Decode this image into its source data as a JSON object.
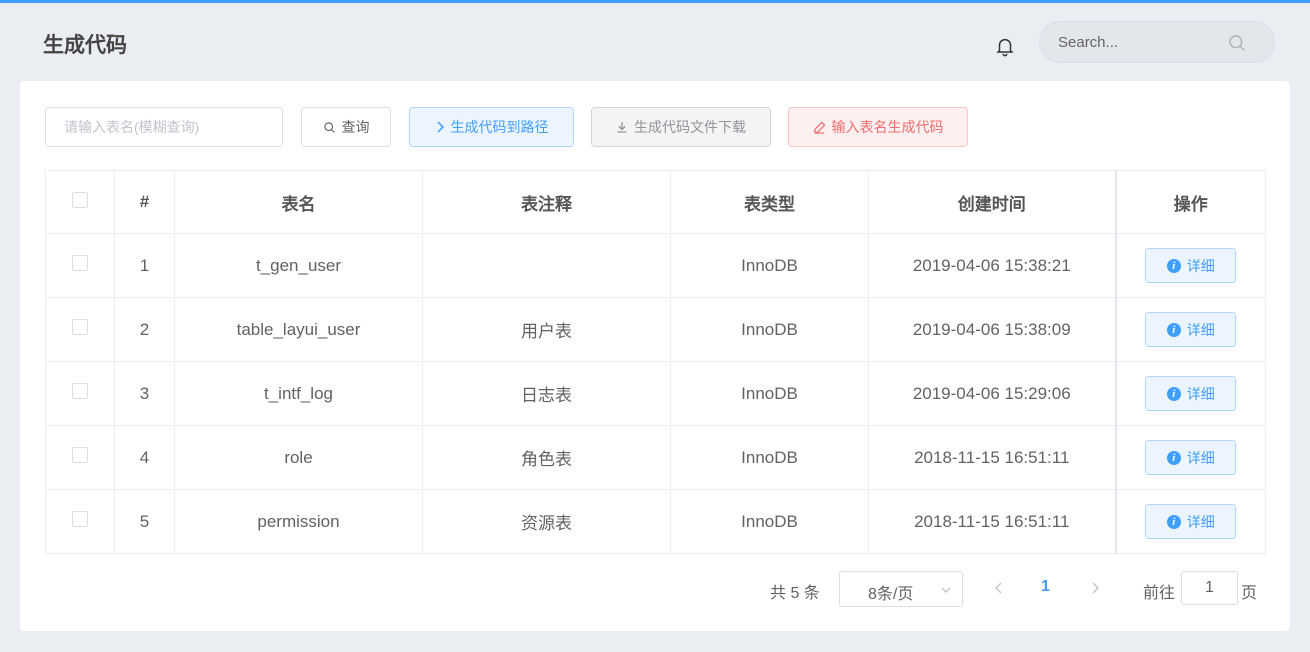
{
  "header": {
    "title": "生成代码",
    "search_placeholder": "Search..."
  },
  "toolbar": {
    "table_name_placeholder": "请输入表名(模糊查询)",
    "query_label": "查询",
    "gen_to_path_label": "生成代码到路径",
    "download_label": "生成代码文件下载",
    "input_gen_label": "输入表名生成代码"
  },
  "table": {
    "columns": [
      "#",
      "表名",
      "表注释",
      "表类型",
      "创建时间",
      "操作"
    ],
    "detail_label": "详细",
    "rows": [
      {
        "index": "1",
        "name": "t_gen_user",
        "comment": "",
        "type": "InnoDB",
        "created": "2019-04-06 15:38:21"
      },
      {
        "index": "2",
        "name": "table_layui_user",
        "comment": "用户表",
        "type": "InnoDB",
        "created": "2019-04-06 15:38:09"
      },
      {
        "index": "3",
        "name": "t_intf_log",
        "comment": "日志表",
        "type": "InnoDB",
        "created": "2019-04-06 15:29:06"
      },
      {
        "index": "4",
        "name": "role",
        "comment": "角色表",
        "type": "InnoDB",
        "created": "2018-11-15 16:51:11"
      },
      {
        "index": "5",
        "name": "permission",
        "comment": "资源表",
        "type": "InnoDB",
        "created": "2018-11-15 16:51:11"
      }
    ]
  },
  "pagination": {
    "total_text": "共 5 条",
    "page_size": "8条/页",
    "current_page": "1",
    "goto_label": "前往",
    "goto_value": "1",
    "goto_suffix": "页"
  },
  "colors": {
    "accent": "#409eff",
    "danger": "#f56c6c",
    "info": "#909399"
  }
}
